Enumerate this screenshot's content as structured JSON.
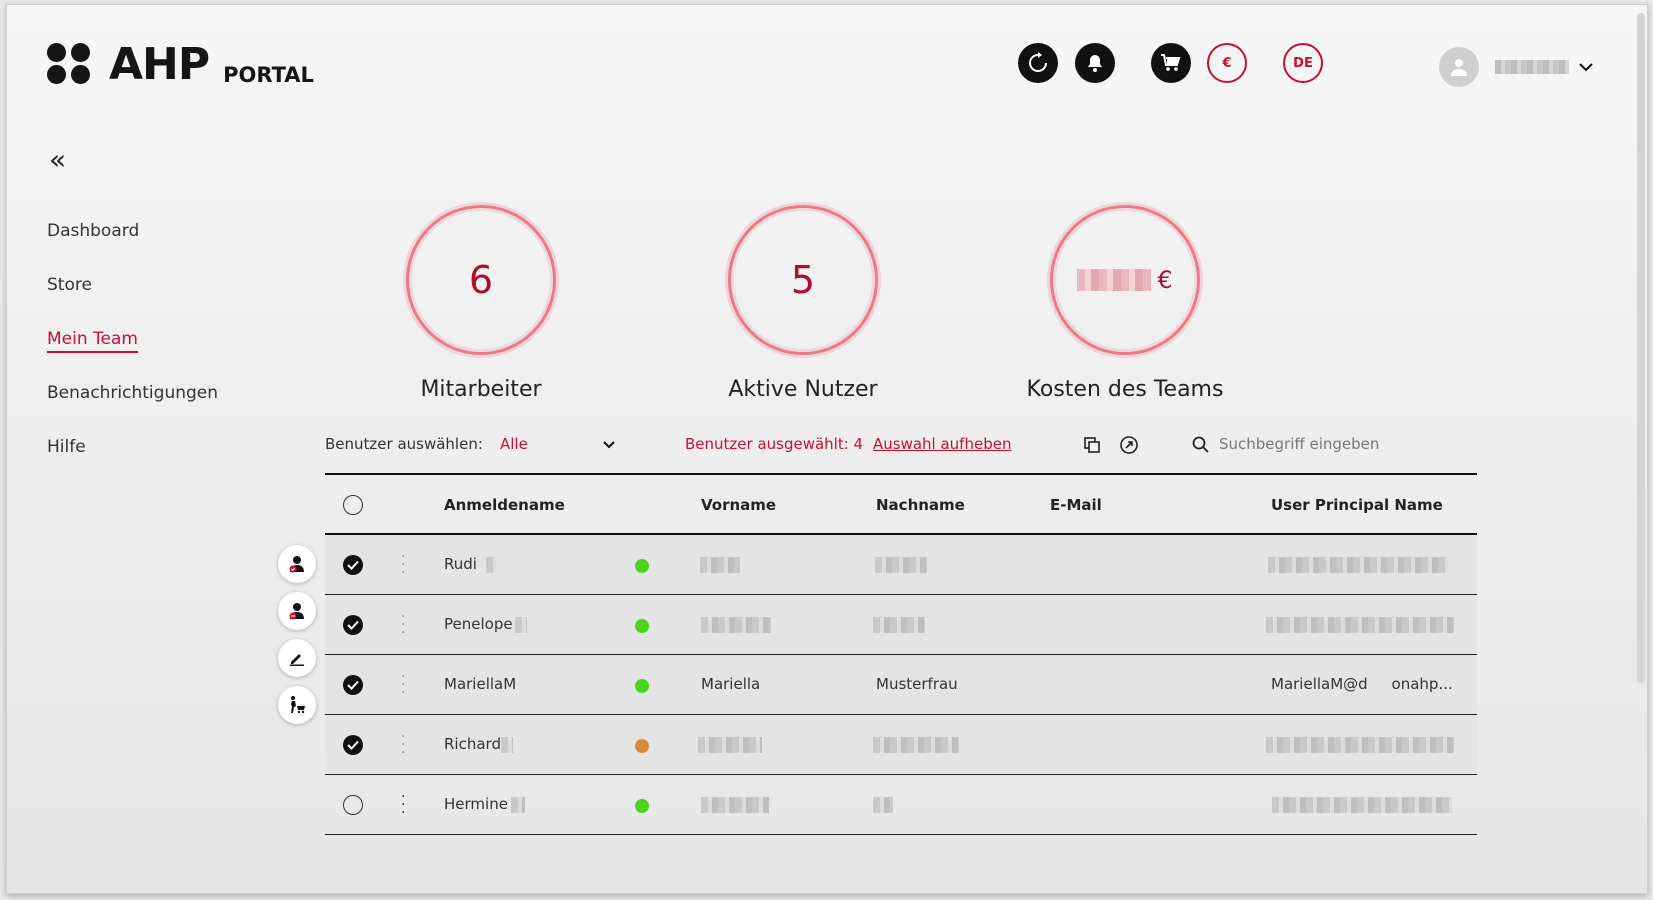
{
  "logo": {
    "mark": "AHP",
    "sub": "PORTAL"
  },
  "header": {
    "currency_label": "€",
    "language_label": "DE"
  },
  "sidebar": {
    "collapse_label": "«",
    "items": [
      {
        "label": "Dashboard"
      },
      {
        "label": "Store"
      },
      {
        "label": "Mein Team",
        "active": true
      },
      {
        "label": "Benachrichtigungen"
      },
      {
        "label": "Hilfe"
      }
    ]
  },
  "stats": {
    "employees": {
      "value": "6",
      "label": "Mitarbeiter"
    },
    "active_users": {
      "value": "5",
      "label": "Aktive Nutzer"
    },
    "team_cost": {
      "currency": "€",
      "label": "Kosten des Teams"
    }
  },
  "toolbar": {
    "select_label": "Benutzer auswählen:",
    "select_value": "Alle",
    "selected_text": "Benutzer ausgewählt: 4",
    "deselect_label": "Auswahl aufheben",
    "search_placeholder": "Suchbegriff eingeben"
  },
  "table": {
    "columns": [
      "Anmeldename",
      "Vorname",
      "Nachname",
      "E-Mail",
      "User Principal Name"
    ],
    "rows": [
      {
        "login": "Rudi",
        "first": "",
        "last": "",
        "email": "",
        "upn": "",
        "status": "active",
        "selected": true
      },
      {
        "login": "Penelope",
        "first": "",
        "last": "",
        "email": "",
        "upn": "",
        "status": "active",
        "selected": true
      },
      {
        "login": "MariellaM",
        "first": "Mariella",
        "last": "Musterfrau",
        "email": "",
        "upn": "MariellaM@d     onahp...",
        "status": "active",
        "selected": true
      },
      {
        "login": "Richard",
        "first": "",
        "last": "",
        "email": "",
        "upn": "",
        "status": "pending",
        "selected": true
      },
      {
        "login": "Hermine",
        "first": "",
        "last": "",
        "email": "",
        "upn": "",
        "status": "active",
        "selected": false
      }
    ]
  },
  "colors": {
    "accent": "#c8102e",
    "status_active": "#4cd31e",
    "status_pending": "#d8893a"
  }
}
